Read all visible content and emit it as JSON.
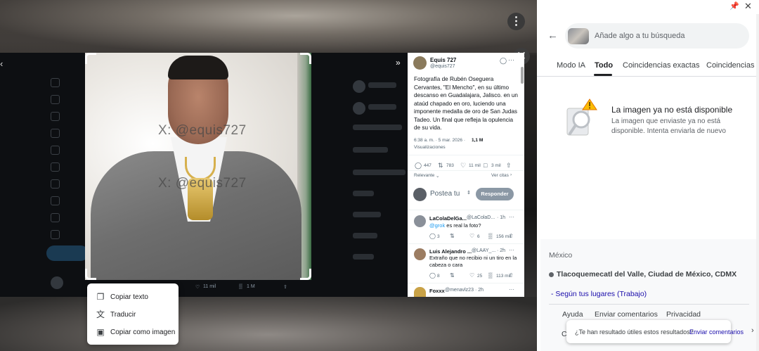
{
  "capture": {
    "watermark_1": "X:  @equis727",
    "watermark_2": "X:  @equis727",
    "more_icon": "more-vert",
    "close_icon": "close",
    "viewer_stats": {
      "likes": "11 mil",
      "views": "1 M"
    }
  },
  "tweet": {
    "author_name": "Equis 727",
    "author_handle": "@equis727",
    "body": "Fotografía de Rubén Oseguera Cervantes, \"El Mencho\", en su último descanso en Guadalajara, Jalisco. en un ataúd chapado en oro, luciendo una imponente medalla de oro de San Judas Tadeo. Un final que refleja la opulencia de su vida.",
    "time": "6:38 a. m. · 5 mar. 2026 ·",
    "views_count": "1,1 M",
    "views_label": "Visualizaciones",
    "replies": "447",
    "retweets": "783",
    "likes": "11 mil",
    "bookmarks": "3 mil",
    "relevance_label": "Relevante",
    "view_quotes_label": "Ver citas",
    "compose_placeholder": "Postea tu",
    "reply_button": "Responder"
  },
  "replies": [
    {
      "name": "LaColaDelGa...",
      "handle": "@LaColaD...",
      "time": "· 1h",
      "mention": "@grok",
      "text": " es real la foto?",
      "replies": "3",
      "likes": "6",
      "views": "156 mil"
    },
    {
      "name": "Luis Alejandro ...",
      "handle": "@LAAY_...",
      "time": "· 2h",
      "text": "Extraño que no recibio ni un tiro en la cabeza o cara",
      "replies": "8",
      "likes": "25",
      "views": "113 mil"
    },
    {
      "name": "Foxxx",
      "handle": "@menavlz23",
      "time": "· 2h"
    }
  ],
  "context_menu": {
    "items": [
      {
        "icon": "copy-text",
        "label": "Copiar texto"
      },
      {
        "icon": "translate",
        "label": "Traducir"
      },
      {
        "icon": "copy-image",
        "label": "Copiar como imagen"
      }
    ]
  },
  "lens": {
    "search_placeholder": "Añade algo a tu búsqueda",
    "tabs": [
      "Modo IA",
      "Todo",
      "Coincidencias exactas",
      "Coincidencias v"
    ],
    "active_tab": "Todo",
    "error_title": "La imagen ya no está disponible",
    "error_text": "La imagen que enviaste ya no está disponible. Intenta enviarla de nuevo",
    "country": "México",
    "location": "Tlacoquemecatl del Valle, Ciudad de México, CDMX",
    "places_link": "- Según tus lugares (Trabajo)",
    "footer_links": [
      "Ayuda",
      "Enviar comentarios",
      "Privacidad"
    ],
    "footer_c": "C",
    "feedback_question": "¿Te han resultado útiles estos resultados?",
    "feedback_link": "Enviar comentarios"
  },
  "colors": {
    "twitter_blue": "#1d9bf0",
    "google_link": "#1a0dab",
    "tab_active": "#202124"
  }
}
